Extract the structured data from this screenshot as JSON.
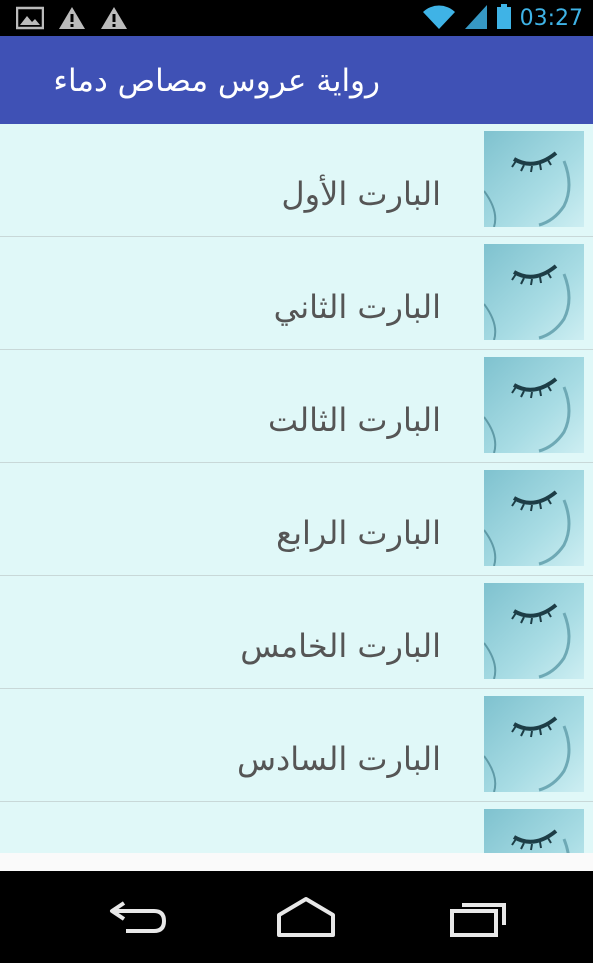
{
  "status_bar": {
    "time": "03:27",
    "icons": [
      "image-notification-icon",
      "warning-icon",
      "warning-icon",
      "wifi-icon",
      "signal-icon",
      "battery-icon"
    ]
  },
  "action_bar": {
    "title": "رواية عروس مصاص دماء",
    "color": "#3f51b5"
  },
  "list": {
    "background": "#e0f8f8",
    "items": [
      {
        "label": "البارت الأول"
      },
      {
        "label": "البارت الثاني"
      },
      {
        "label": "البارت الثالت"
      },
      {
        "label": "البارت الرابع"
      },
      {
        "label": "البارت الخامس"
      },
      {
        "label": "البارت السادس"
      },
      {
        "label": ""
      }
    ]
  },
  "nav_bar": {
    "buttons": [
      "back-icon",
      "home-icon",
      "recent-apps-icon"
    ]
  }
}
